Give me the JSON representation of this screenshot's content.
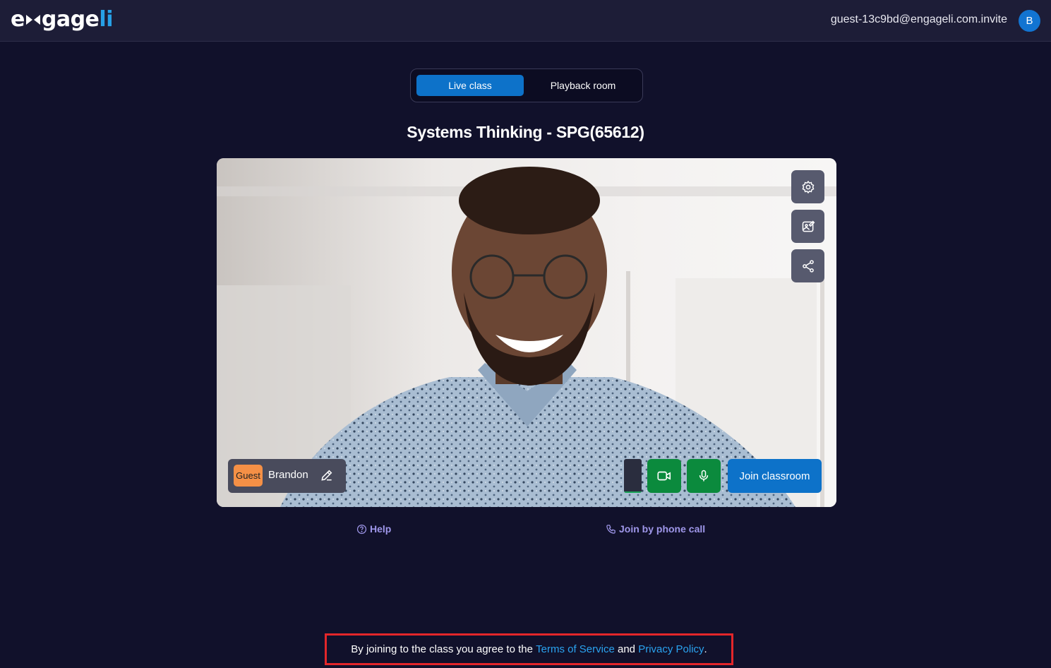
{
  "header": {
    "logo_text_a": "e",
    "logo_text_b": "gage",
    "logo_text_c": "li",
    "user_email": "guest-13c9bd@engageli.com.invite",
    "avatar_initial": "B"
  },
  "tabs": [
    {
      "label": "Live class",
      "active": true
    },
    {
      "label": "Playback room",
      "active": false
    }
  ],
  "page_title": "Systems Thinking - SPG(65612)",
  "video": {
    "side_buttons": [
      "gear-icon",
      "gallery-edit-icon",
      "share-icon"
    ],
    "badge": "Guest",
    "participant_name": "Brandon",
    "join_label": "Join classroom",
    "audio_level": 0.05
  },
  "links": {
    "help": "Help",
    "phone": "Join by phone call"
  },
  "footer": {
    "prefix": "By joining to the class you agree to the ",
    "terms": "Terms of Service",
    "middle": " and ",
    "privacy": "Privacy Policy",
    "suffix": "."
  },
  "colors": {
    "background": "#11112b",
    "accent": "#0d72c9",
    "success": "#0b8a3d",
    "link": "#9f97ea",
    "guest_badge": "#f59046",
    "highlight": "#e3262a"
  }
}
